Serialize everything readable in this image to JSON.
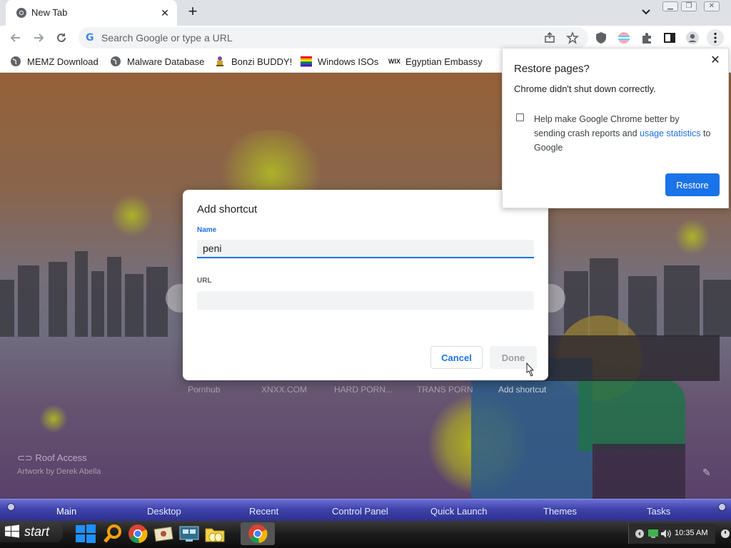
{
  "browser": {
    "tab": {
      "title": "New Tab"
    },
    "omnibox": {
      "placeholder": "Search Google or type a URL"
    },
    "bookmarks": [
      {
        "label": "MEMZ Download",
        "icon": "globe-icon"
      },
      {
        "label": "Malware Database",
        "icon": "globe-icon"
      },
      {
        "label": "Bonzi BUDDY!",
        "icon": "bonzi-icon"
      },
      {
        "label": "Windows ISOs",
        "icon": "rainbow-flag-icon"
      },
      {
        "label": "Egyptian Embassy",
        "icon": "wix-icon"
      }
    ]
  },
  "newtab": {
    "shortcuts": [
      "Pornhub",
      "XNXX.COM",
      "HARD PORN...",
      "TRANS PORN",
      "Add shortcut"
    ],
    "credit": {
      "title": "Roof Access",
      "artist": "Artwork by Derek Abella"
    }
  },
  "dialog": {
    "title": "Add shortcut",
    "name_label": "Name",
    "name_value": "peni",
    "url_label": "URL",
    "url_value": "",
    "cancel": "Cancel",
    "done": "Done"
  },
  "restore_popup": {
    "title": "Restore pages?",
    "message": "Chrome didn't shut down correctly.",
    "help_prefix": "Help make Google Chrome better by sending crash reports and",
    "help_link": "usage statistics",
    "help_suffix": "to Google",
    "checkbox_checked": false,
    "button": "Restore"
  },
  "launcher": {
    "items": [
      "Main",
      "Desktop",
      "Recent",
      "Control Panel",
      "Quick Launch",
      "Themes",
      "Tasks"
    ],
    "active": "Main"
  },
  "taskbar": {
    "start_label": "start",
    "clock": "10:35 AM"
  },
  "colors": {
    "accent": "#1a73e8",
    "launcher": "#3f42a8",
    "taskbar": "#1b1b1b"
  }
}
